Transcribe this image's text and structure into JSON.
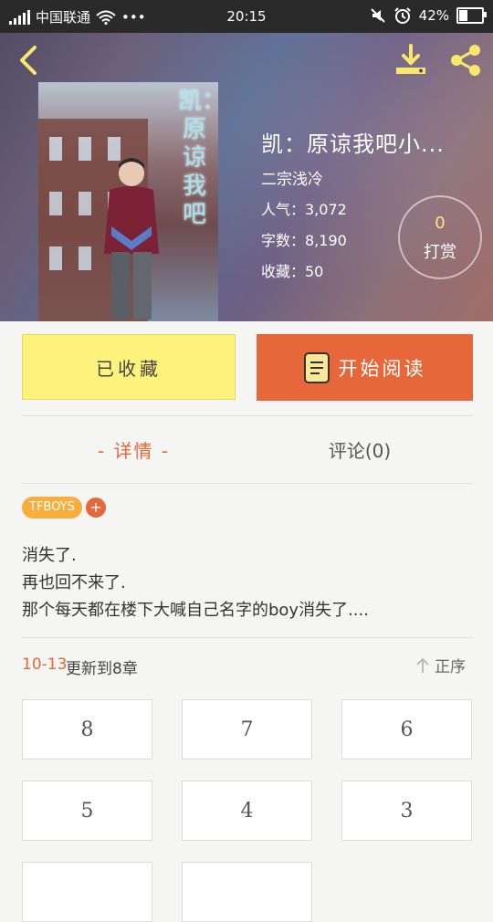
{
  "status_bar": {
    "carrier": "中国联通",
    "dots": "•••",
    "time": "20:15",
    "battery": "42%",
    "battery_fraction": 0.42
  },
  "header": {
    "back_icon": "chevron-left-icon",
    "download_icon": "download-icon",
    "share_icon": "share-icon"
  },
  "cover": {
    "title_text": "凯：原谅我吧"
  },
  "book": {
    "title": "凯：原谅我吧小...",
    "author": "二宗浅冷",
    "popularity": "人气：3,072",
    "word_count": "字数：8,190",
    "favorites": "收藏：50"
  },
  "reward": {
    "count": "0",
    "label": "打赏"
  },
  "actions": {
    "collect_label": "已收藏",
    "read_label": "开始阅读"
  },
  "tabs": {
    "details": "- 详情 -",
    "comments": "评论(0)"
  },
  "tags": {
    "tag1": "TFBOYS",
    "add": "+"
  },
  "synopsis": {
    "line1": "消失了.",
    "line2": "再也回不来了.",
    "line3": "那个每天都在楼下大喊自己名字的boy消失了...."
  },
  "update": {
    "date": "10-13",
    "text": "更新到8章",
    "sort_label": "正序"
  },
  "chapters": [
    "8",
    "7",
    "6",
    "5",
    "4",
    "3",
    "",
    ""
  ],
  "colors": {
    "accent": "#e6673a",
    "collect_bg": "#fdf37c",
    "tag": "#f7ae3c"
  }
}
